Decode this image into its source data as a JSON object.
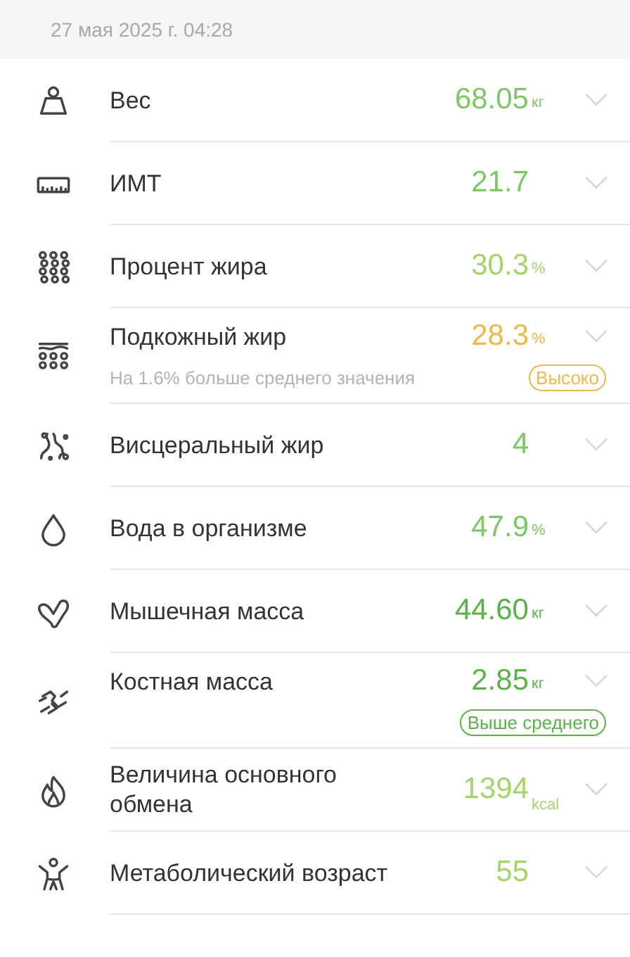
{
  "date": "27 мая 2025 г. 04:28",
  "metrics": [
    {
      "label": "Вес",
      "value": "68.05",
      "unit": "кг",
      "color": "#7cc766",
      "expanded": false
    },
    {
      "label": "ИМТ",
      "value": "21.7",
      "color": "#7cc766",
      "expanded": false
    },
    {
      "label": "Процент жира",
      "value": "30.3",
      "unit": "%",
      "color": "#a5d46a",
      "expanded": false
    },
    {
      "label": "Подкожный жир",
      "value": "28.3",
      "unit": "%",
      "color": "#efb84a",
      "expanded": false,
      "note": "На 1.6% больше среднего значения",
      "badge": "Высоко"
    },
    {
      "label": "Висцеральный жир",
      "value": "4",
      "color": "#7cc766",
      "expanded": false
    },
    {
      "label": "Вода в организме",
      "value": "47.9",
      "unit": "%",
      "color": "#7cc766",
      "expanded": false
    },
    {
      "label": "Мышечная масса",
      "value": "44.60",
      "unit": "кг",
      "color": "#5bb24a",
      "expanded": false
    },
    {
      "label": "Костная масса",
      "value": "2.85",
      "unit": "кг",
      "color": "#5bb24a",
      "expanded": false,
      "badge": "Выше среднего"
    },
    {
      "label": "Величина основного обмена",
      "value": "1394",
      "unit": "kcal",
      "color": "#a5d46a",
      "expanded": false
    },
    {
      "label": "Метаболический возраст",
      "value": "55",
      "color": "#a5d46a",
      "expanded": false
    }
  ]
}
